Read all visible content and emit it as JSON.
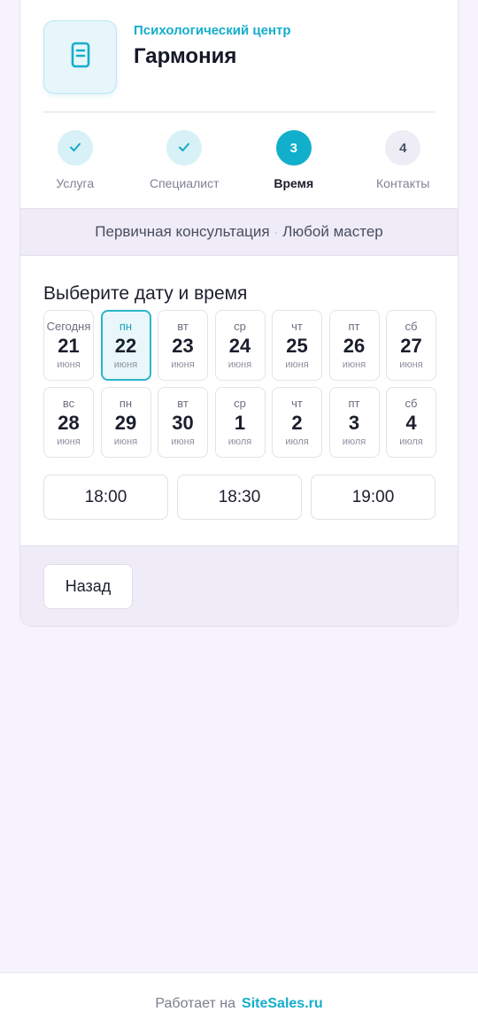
{
  "org": {
    "subtitle": "Психологический центр",
    "title": "Гармония",
    "logo_icon": "document-icon"
  },
  "steps": [
    {
      "label": "Услуга",
      "state": "done",
      "number": "1"
    },
    {
      "label": "Специалист",
      "state": "done",
      "number": "2"
    },
    {
      "label": "Время",
      "state": "active",
      "number": "3"
    },
    {
      "label": "Контакты",
      "state": "todo",
      "number": "4"
    }
  ],
  "summary": {
    "service": "Первичная консультация",
    "separator": "·",
    "master": "Любой мастер"
  },
  "section_title": "Выберите дату и время",
  "days": [
    {
      "dow": "Сегодня",
      "num": "21",
      "month": "июня"
    },
    {
      "dow": "пн",
      "num": "22",
      "month": "июня",
      "selected": true
    },
    {
      "dow": "вт",
      "num": "23",
      "month": "июня"
    },
    {
      "dow": "ср",
      "num": "24",
      "month": "июня"
    },
    {
      "dow": "чт",
      "num": "25",
      "month": "июня"
    },
    {
      "dow": "пт",
      "num": "26",
      "month": "июня"
    },
    {
      "dow": "сб",
      "num": "27",
      "month": "июня"
    },
    {
      "dow": "вс",
      "num": "28",
      "month": "июня"
    },
    {
      "dow": "пн",
      "num": "29",
      "month": "июня"
    },
    {
      "dow": "вт",
      "num": "30",
      "month": "июня"
    },
    {
      "dow": "ср",
      "num": "1",
      "month": "июля"
    },
    {
      "dow": "чт",
      "num": "2",
      "month": "июля"
    },
    {
      "dow": "пт",
      "num": "3",
      "month": "июля"
    },
    {
      "dow": "сб",
      "num": "4",
      "month": "июля"
    }
  ],
  "times": [
    "18:00",
    "18:30",
    "19:00"
  ],
  "back_label": "Назад",
  "footer": {
    "text": "Работает на",
    "brand": "SiteSales.ru"
  },
  "colors": {
    "accent": "#11afcc",
    "background": "#f6f3fc"
  }
}
